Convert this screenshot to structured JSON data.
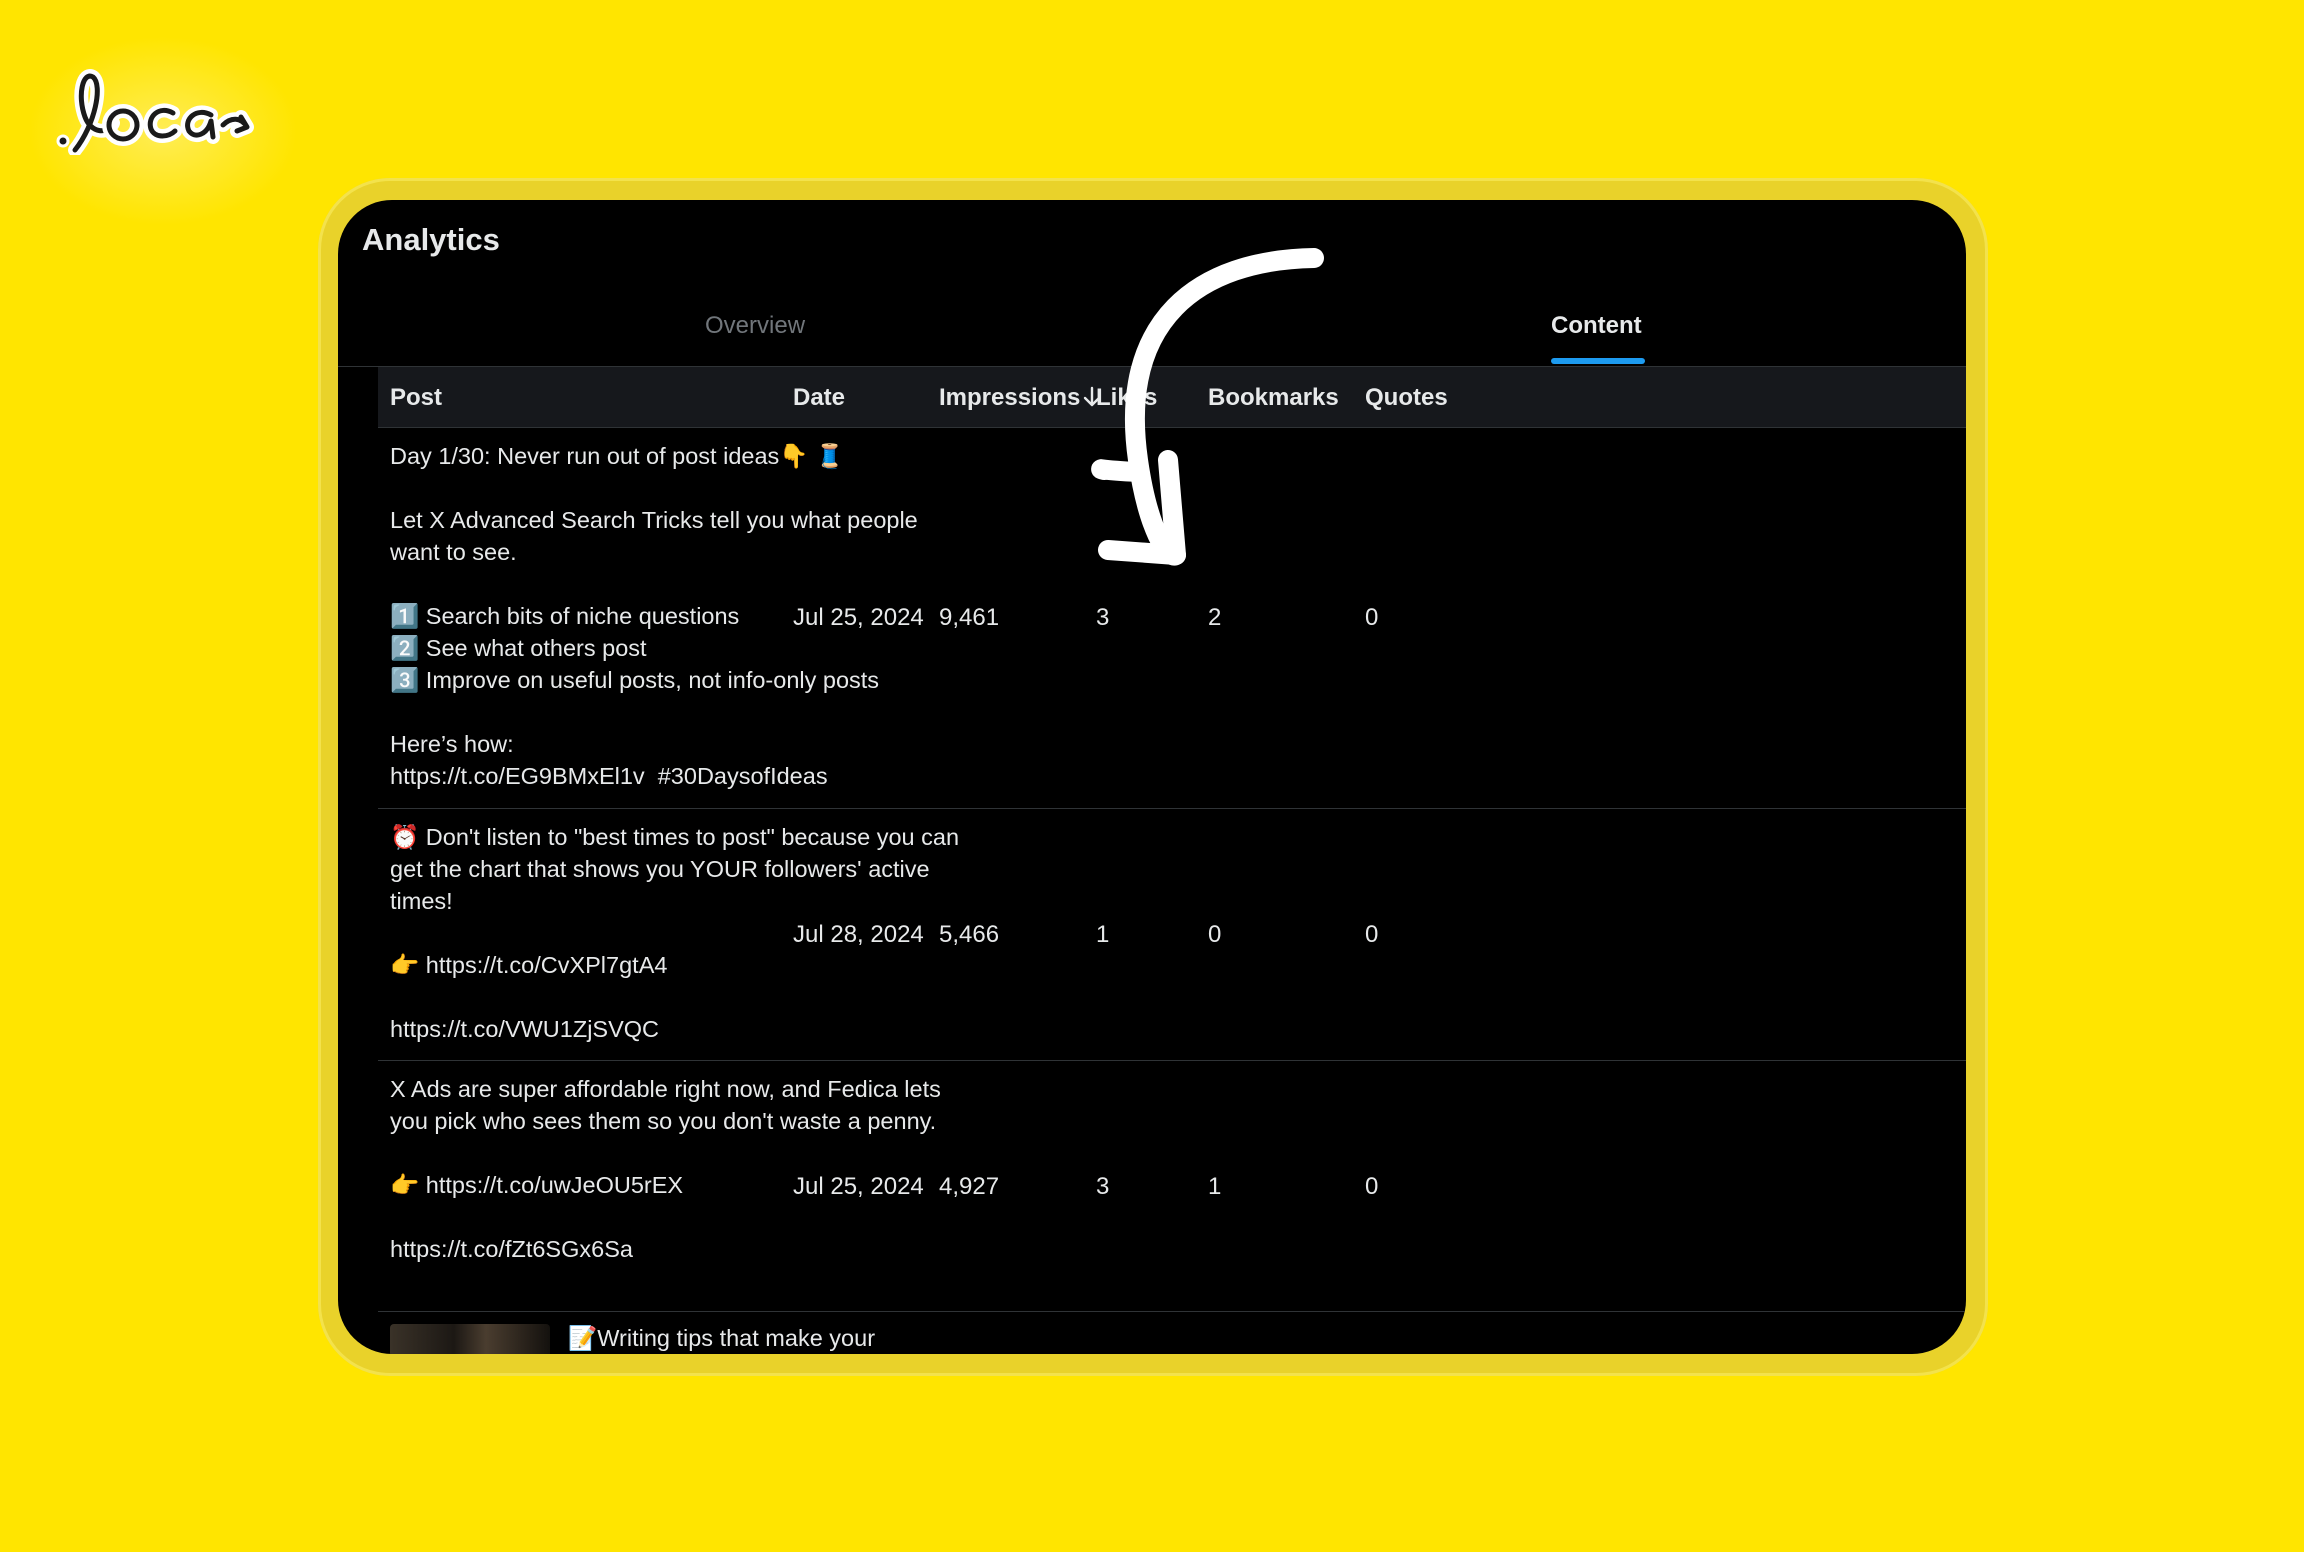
{
  "brand": {
    "logo_text": "loca"
  },
  "page": {
    "title": "Analytics"
  },
  "tabs": [
    {
      "label": "Overview",
      "active": false
    },
    {
      "label": "Content",
      "active": true
    }
  ],
  "table": {
    "columns": [
      "Post",
      "Date",
      "Impressions",
      "Likes",
      "Bookmarks",
      "Quotes"
    ],
    "sort": {
      "column": "Impressions",
      "direction": "descending"
    },
    "rows": [
      {
        "post": "Day 1/30: Never run out of post ideas👇 🧵\n\nLet X Advanced Search Tricks tell you what people want to see.\n\n1️⃣ Search bits of niche questions\n2️⃣ See what others post\n3️⃣ Improve on useful posts, not info-only posts\n\nHere’s how:\nhttps://t.co/EG9BMxEl1v  #30DaysofIdeas",
        "date": "Jul 25, 2024",
        "impressions": "9,461",
        "likes": "3",
        "bookmarks": "2",
        "quotes": "0"
      },
      {
        "post": "⏰ Don't listen to \"best times to post\" because you can get the chart that shows you YOUR followers' active times!\n\n👉 https://t.co/CvXPl7gtA4\n\nhttps://t.co/VWU1ZjSVQC",
        "date": "Jul 28, 2024",
        "impressions": "5,466",
        "likes": "1",
        "bookmarks": "0",
        "quotes": "0"
      },
      {
        "post": "X Ads are super affordable right now, and Fedica lets you pick who sees them so you don't waste a penny.\n\n👉 https://t.co/uwJeOU5rEX\n\nhttps://t.co/fZt6SGx6Sa",
        "date": "Jul 25, 2024",
        "impressions": "4,927",
        "likes": "3",
        "bookmarks": "1",
        "quotes": "0"
      },
      {
        "post": "📝Writing tips that make your",
        "has_thumbnail": true
      }
    ]
  },
  "icons": {
    "sort": "arrow-down-icon",
    "annotation": "curved-arrow-icon"
  },
  "colors": {
    "background": "#FFE500",
    "screen": "#000000",
    "accent": "#1D9BF0",
    "text": "#E7E9EA",
    "muted": "#71767B"
  }
}
